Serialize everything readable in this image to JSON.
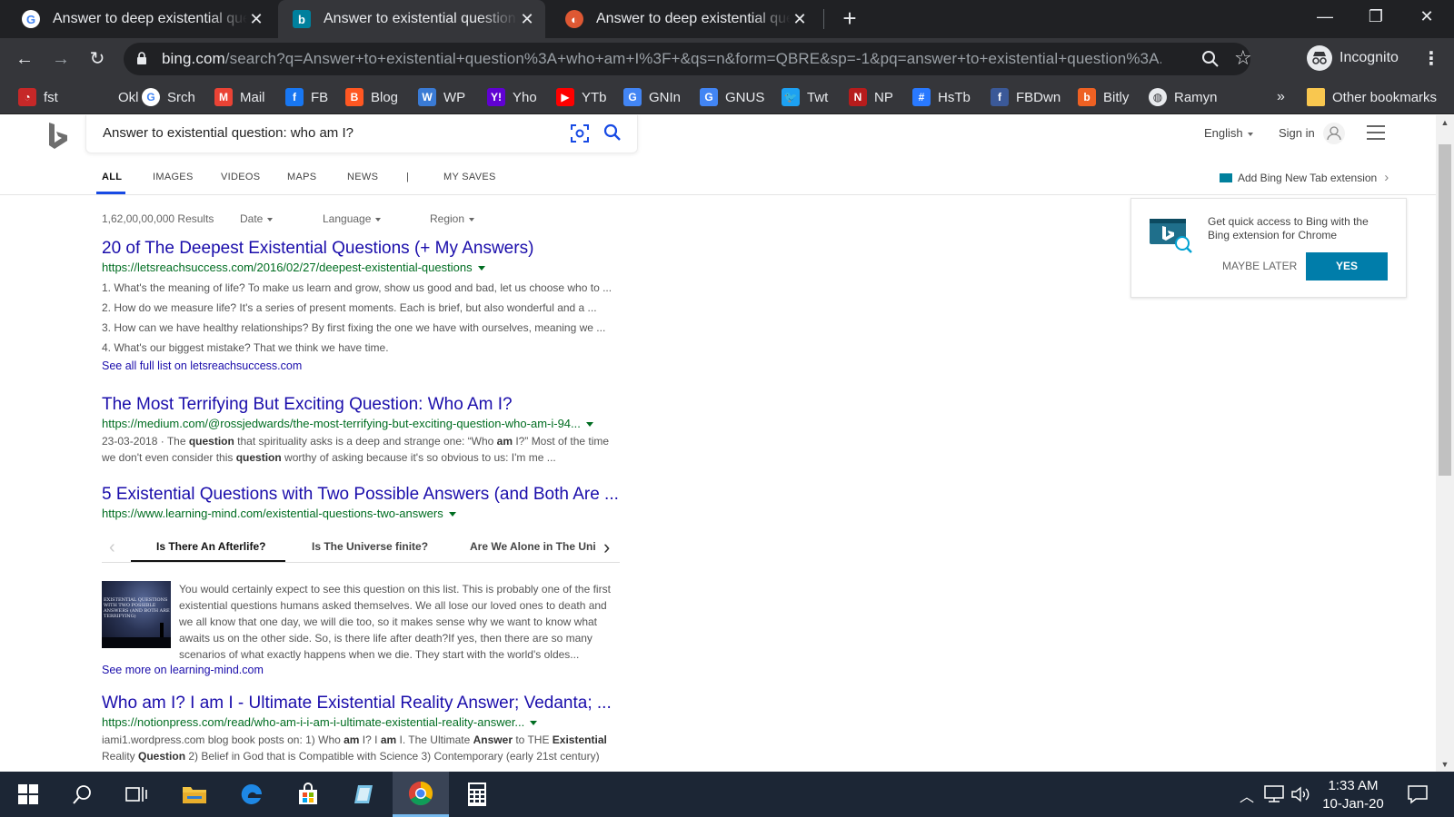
{
  "browser": {
    "tabs": [
      {
        "title": "Answer to deep existential questi",
        "favicon": "google-icon",
        "active": false
      },
      {
        "title": "Answer to existential question: w",
        "favicon": "bing-icon",
        "active": true
      },
      {
        "title": "Answer to deep existential questi",
        "favicon": "duckduckgo-icon",
        "active": false
      }
    ],
    "url_host": "bing.com",
    "url_path": "/search?q=Answer+to+existential+question%3A+who+am+I%3F+&qs=n&form=QBRE&sp=-1&pq=answer+to+existential+question%3A...",
    "profile_label": "Incognito",
    "bookmarks": [
      {
        "label": "fst",
        "icon": "gauge-icon",
        "color": "#c62828"
      },
      {
        "label": "Okl",
        "icon": "blank-icon",
        "color": "#35363a"
      },
      {
        "label": "Srch",
        "icon": "google-icon",
        "color": "#ffffff"
      },
      {
        "label": "Mail",
        "icon": "gmail-icon",
        "color": "#ea4335"
      },
      {
        "label": "FB",
        "icon": "facebook-icon",
        "color": "#1877f2"
      },
      {
        "label": "Blog",
        "icon": "blogger-icon",
        "color": "#ff5722"
      },
      {
        "label": "WP",
        "icon": "wordpress-icon",
        "color": "#3a7bd5"
      },
      {
        "label": "Yho",
        "icon": "yahoo-icon",
        "color": "#6001d2"
      },
      {
        "label": "YTb",
        "icon": "youtube-icon",
        "color": "#ff0000"
      },
      {
        "label": "GNIn",
        "icon": "google-news-icon",
        "color": "#4285f4"
      },
      {
        "label": "GNUS",
        "icon": "google-news-icon",
        "color": "#4285f4"
      },
      {
        "label": "Twt",
        "icon": "twitter-icon",
        "color": "#1da1f2"
      },
      {
        "label": "NP",
        "icon": "np-icon",
        "color": "#b71c1c"
      },
      {
        "label": "HsTb",
        "icon": "hashtag-icon",
        "color": "#2979ff"
      },
      {
        "label": "FBDwn",
        "icon": "facebook-icon",
        "color": "#3b5998"
      },
      {
        "label": "Bitly",
        "icon": "bitly-icon",
        "color": "#ee6123"
      },
      {
        "label": "Ramyn",
        "icon": "globe-icon",
        "color": "#e8eaed"
      }
    ],
    "overflow_label": "»",
    "other_bookmarks_label": "Other bookmarks"
  },
  "bing": {
    "query": "Answer to existential question: who am I?",
    "language_label": "English",
    "signin_label": "Sign in",
    "scopes": [
      "ALL",
      "IMAGES",
      "VIDEOS",
      "MAPS",
      "NEWS",
      "|",
      "MY SAVES"
    ],
    "extension_link": "Add Bing New Tab extension",
    "results_count": "1,62,00,00,000 Results",
    "filters": [
      "Date",
      "Language",
      "Region"
    ],
    "results": [
      {
        "title": "20 of The Deepest Existential Questions (+ My Answers)",
        "url": "https://letsreachsuccess.com/2016/02/27/deepest-existential-questions",
        "lines": [
          "1. What's the meaning of life? To make us learn and grow, show us good and bad, let us choose who to ...",
          "2. How do we measure life? It's a series of present moments. Each is brief, but also wonderful and a ...",
          "3. How can we have healthy relationships? By first fixing the one we have with ourselves, meaning we ...",
          "4. What's our biggest mistake? That we think we have time."
        ],
        "more": "See all full list on letsreachsuccess.com"
      },
      {
        "title": "The Most Terrifying But Exciting Question: Who Am I?",
        "url": "https://medium.com/@rossjedwards/the-most-terrifying-but-exciting-question-who-am-i-94...",
        "snippet_date": "23-03-2018 · The ",
        "snippet_b1": "question",
        "snippet_a": " that spirituality asks is a deep and strange one: “Who ",
        "snippet_b2": "am",
        "snippet_c": " I?” Most of the time",
        "snippet2_a": "we don't even consider this ",
        "snippet2_b": "question",
        "snippet2_c": " worthy of asking because it's so obvious to us: I'm me ..."
      },
      {
        "title": "5 Existential Questions with Two Possible Answers (and Both Are ...",
        "url": "https://www.learning-mind.com/existential-questions-two-answers",
        "tabs": [
          "Is There An Afterlife?",
          "Is The Universe finite?",
          "Are We Alone in The Univ"
        ],
        "thumb_caption": "EXISTENTIAL QUESTIONS WITH TWO POSSIBLE ANSWERS (AND BOTH ARE TERRIFYING)",
        "body": [
          "You would certainly expect to see this question on this list. This is probably one of the first",
          "existential questions humans asked themselves. We all lose our loved ones to death and",
          "we all know that one day, we will die too, so it makes sense why we want to know what",
          "awaits us on the other side. So, is there life after death?If yes, then there are so many",
          "scenarios of what exactly happens when we die. They start with the world's oldes..."
        ],
        "more": "See more on learning-mind.com"
      },
      {
        "title": "Who am I? I am I - Ultimate Existential Reality Answer; Vedanta; ...",
        "url": "https://notionpress.com/read/who-am-i-i-am-i-ultimate-existential-reality-answer...",
        "s_a": "iami1.wordpress.com blog book posts on: 1) Who ",
        "s_b1": "am",
        "s_c": " I? I ",
        "s_b2": "am",
        "s_d": " I. The Ultimate ",
        "s_b3": "Answer",
        "s_e": " to THE ",
        "s_b4": "Existential",
        "s2_a": "Reality ",
        "s2_b": "Question",
        "s2_c": " 2) Belief in God that is Compatible with Science 3) Contemporary (early 21st century)"
      }
    ],
    "promo": {
      "text": "Get quick access to Bing with the Bing extension for Chrome",
      "later_label": "MAYBE LATER",
      "yes_label": "YES"
    }
  },
  "taskbar": {
    "time": "1:33 AM",
    "date": "10-Jan-20"
  }
}
